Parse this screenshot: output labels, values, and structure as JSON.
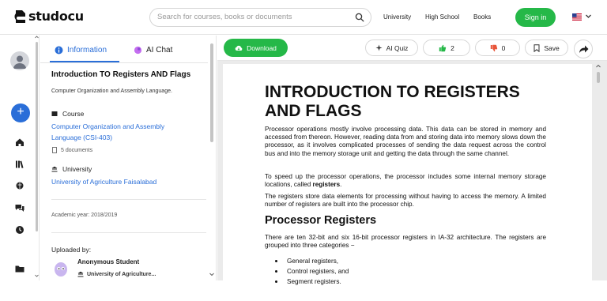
{
  "header": {
    "logo_text": "studocu",
    "search_placeholder": "Search for courses, books or documents",
    "nav": [
      "University",
      "High School",
      "Books"
    ],
    "signin_label": "Sign in",
    "accent_green": "#25b848",
    "accent_blue": "#2a6ed8"
  },
  "sidebar": {
    "icons": [
      "avatar",
      "plus-icon",
      "home-icon",
      "library-icon",
      "brain-icon",
      "chat-icon",
      "clock-icon",
      "folder-icon"
    ]
  },
  "panel": {
    "tabs": [
      "Information",
      "AI Chat"
    ],
    "doc_title": "Introduction TO Registers AND Flags",
    "doc_subtitle": "Computer Organization and Assembly Language.",
    "course_label": "Course",
    "course_name": "Computer Organization and Assembly Language (CSI-403)",
    "course_docs": "5 documents",
    "university_label": "University",
    "university_name": "University of Agriculture Faisalabad",
    "academic_year": "Academic year: 2018/2019",
    "uploaded_by_label": "Uploaded by:",
    "uploader_name": "Anonymous Student",
    "uploader_university": "University of Agriculture..."
  },
  "toolbar": {
    "download_label": "Download",
    "ai_quiz_label": "AI Quiz",
    "likes": "2",
    "dislikes": "0",
    "save_label": "Save"
  },
  "document": {
    "heading": "INTRODUCTION TO REGISTERS AND FLAGS",
    "para1": "Processor operations mostly involve processing data. This data can be stored in memory and accessed from thereon. However, reading data from and storing data into memory slows down the processor, as it involves complicated processes of sending the data request across the control bus and into the memory storage unit and getting the data through the same channel.",
    "para2_pre": "To speed up the processor operations, the processor includes some internal memory storage locations, called ",
    "para2_bold": "registers",
    "para2_post": ".",
    "para3": "The registers store data elements for processing without having to access the memory. A limited number of registers are built into the processor chip.",
    "subheading": "Processor Registers",
    "para4": "There are ten 32-bit and six 16-bit processor registers in IA-32 architecture. The registers are grouped into three categories −",
    "bullets": [
      "General registers,",
      "Control registers, and",
      "Segment registers."
    ]
  }
}
